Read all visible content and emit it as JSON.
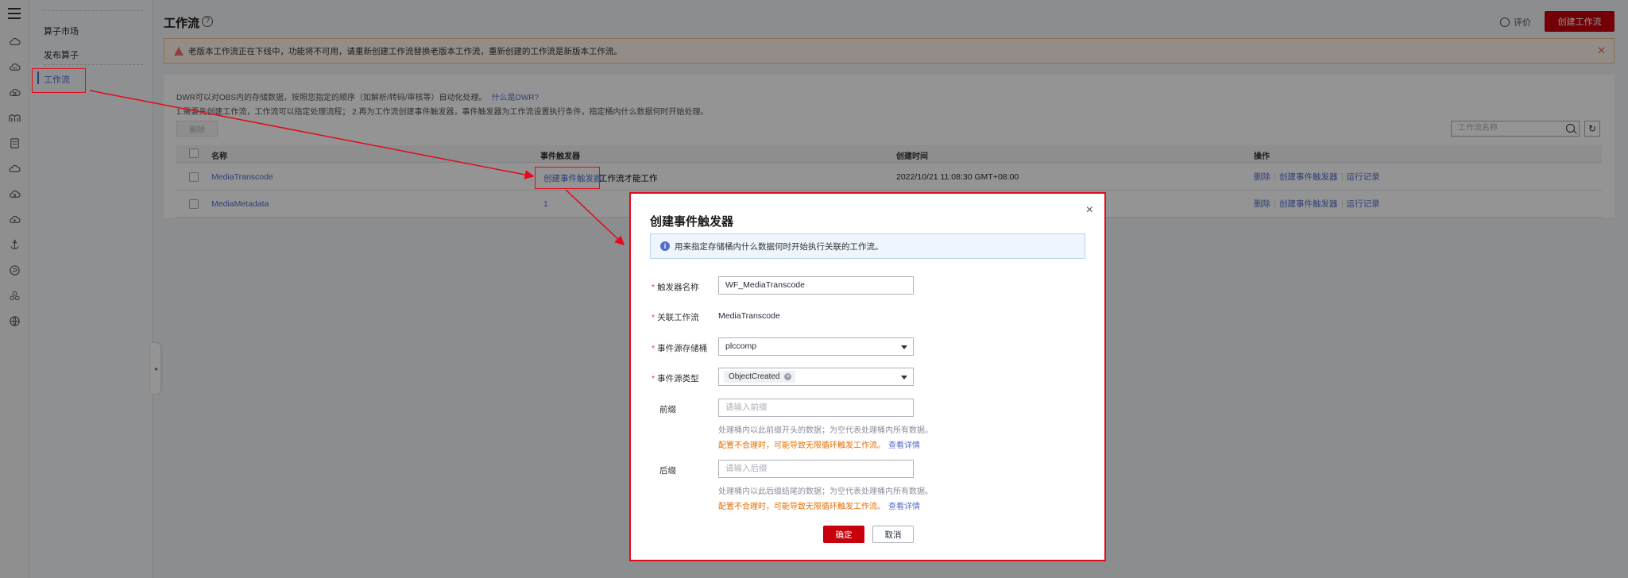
{
  "nav": {
    "items": [
      {
        "label": "算子市场"
      },
      {
        "label": "发布算子"
      },
      {
        "label": "工作流"
      }
    ],
    "collapse_glyph": "◂"
  },
  "header": {
    "title": "工作流",
    "help_glyph": "?",
    "feedback_label": "评价",
    "create_button": "创建工作流"
  },
  "warning": {
    "text": "老版本工作流正在下线中，功能将不可用，请重新创建工作流替换老版本工作流，重新创建的工作流是新版本工作流。",
    "close_glyph": "✕",
    "bang": "!",
    "color": "#f66f6a"
  },
  "description": {
    "line1": "DWR可以对OBS内的存储数据，按照您指定的顺序（如解析/转码/审核等）自动化处理。",
    "line1_link": "什么是DWR?",
    "line2": "1.需要先创建工作流，工作流可以指定处理流程； 2.再为工作流创建事件触发器，事件触发器为工作流设置执行条件，指定桶内什么数据何时开始处理。"
  },
  "toolbar": {
    "delete_label": "删除",
    "search_placeholder": "工作流名称",
    "refresh_glyph": "↻"
  },
  "table": {
    "columns": [
      "名称",
      "事件触发器",
      "创建时间",
      "操作"
    ],
    "rows": [
      {
        "name": "MediaTranscode",
        "trigger_link": "创建事件触发器",
        "trigger_suffix": "工作流才能工作",
        "created": "2022/10/21 11:08:30 GMT+08:00",
        "ops": [
          "删除",
          "创建事件触发器",
          "运行记录"
        ]
      },
      {
        "name": "MediaMetadata",
        "trigger_link": "1",
        "trigger_suffix": "",
        "created": "",
        "ops": [
          "删除",
          "创建事件触发器",
          "运行记录"
        ]
      }
    ]
  },
  "dialog": {
    "title": "创建事件触发器",
    "close_glyph": "×",
    "info_glyph": "i",
    "info": "用来指定存储桶内什么数据何时开始执行关联的工作流。",
    "fields": {
      "trigger_name_label": "触发器名称",
      "trigger_name_value": "WF_MediaTranscode",
      "workflow_label": "关联工作流",
      "workflow_value": "MediaTranscode",
      "bucket_label": "事件源存储桶",
      "bucket_value": "plccomp",
      "event_type_label": "事件源类型",
      "event_type_tag": "ObjectCreated",
      "tag_close_glyph": "×",
      "prefix_label": "前缀",
      "prefix_placeholder": "请输入前缀",
      "prefix_hint": "处理桶内以此前缀开头的数据；为空代表处理桶内所有数据。",
      "prefix_warn": "配置不合理时，可能导致无限循环触发工作流。",
      "prefix_link": "查看详情",
      "suffix_label": "后缀",
      "suffix_placeholder": "请输入后缀",
      "suffix_hint": "处理桶内以此后缀结尾的数据；为空代表处理桶内所有数据。",
      "suffix_warn": "配置不合理时，可能导致无限循环触发工作流。",
      "suffix_link": "查看详情",
      "required_mark": "*"
    },
    "ok_label": "确定",
    "cancel_label": "取消"
  },
  "colors": {
    "accent_red": "#c7000b",
    "link_blue": "#526ecc",
    "annotation_red": "#e10b1b"
  },
  "icons": [
    "menu-icon",
    "cloud-icon",
    "cloud-dots-icon",
    "cloud-home-icon",
    "bridge-icon",
    "database-icon",
    "cloud-outline-icon",
    "cloud-gear-icon",
    "cloud-upload-icon",
    "anchor-icon",
    "coin-icon",
    "cluster-icon",
    "globe-icon"
  ]
}
